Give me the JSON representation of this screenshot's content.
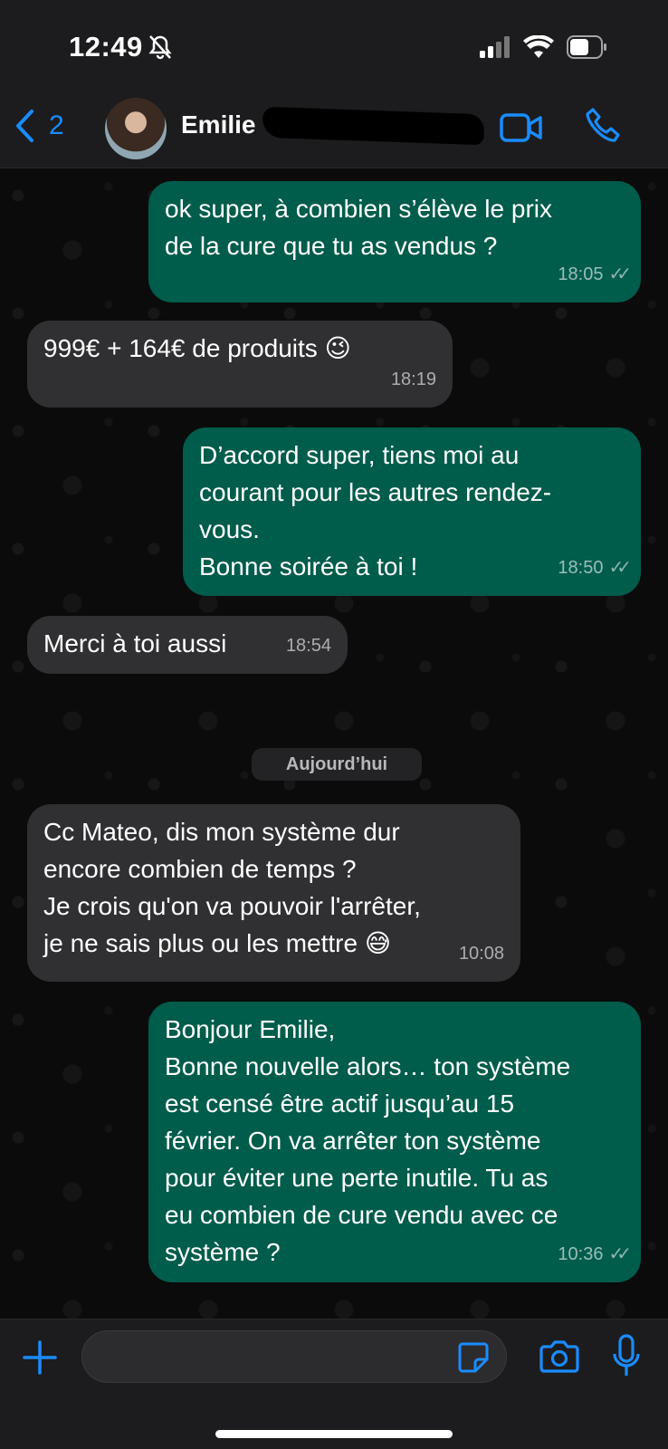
{
  "status": {
    "time": "12:49"
  },
  "header": {
    "back_count": "2",
    "contact_name": "Emilie"
  },
  "day_separator": "Aujourd’hui",
  "messages": [
    {
      "dir": "out",
      "text": "ok super, à combien s’élève le prix\nde la cure que tu as vendus ?",
      "time": "18:05"
    },
    {
      "dir": "in",
      "text": "999€ + 164€ de produits 😉",
      "time": "18:19"
    },
    {
      "dir": "out",
      "text": "D’accord super, tiens moi au\ncourant pour les autres rendez-\nvous.\nBonne soirée à toi !",
      "time": "18:50"
    },
    {
      "dir": "in",
      "text": "Merci à toi aussi",
      "time": "18:54"
    },
    {
      "dir": "in",
      "text": "Cc Mateo, dis mon système dur\nencore combien de temps ?\nJe crois qu'on va pouvoir l'arrêter,\nje ne sais plus ou les mettre 😅",
      "time": "10:08"
    },
    {
      "dir": "out",
      "text": "Bonjour Emilie,\nBonne nouvelle alors… ton système\nest censé être actif jusqu’au 15\nfévrier. On va arrêter ton système\npour éviter une perte inutile. Tu as\neu combien de cure vendu avec ce\nsystème ?",
      "time": "10:36"
    }
  ],
  "colors": {
    "outgoing": "#005c4b",
    "incoming": "#303033",
    "accent": "#1a8cff"
  },
  "icons": [
    "bell-slash-icon",
    "signal-icon",
    "wifi-icon",
    "battery-icon",
    "chevron-left-icon",
    "video-call-icon",
    "phone-icon",
    "plus-icon",
    "sticker-icon",
    "camera-icon",
    "microphone-icon"
  ]
}
